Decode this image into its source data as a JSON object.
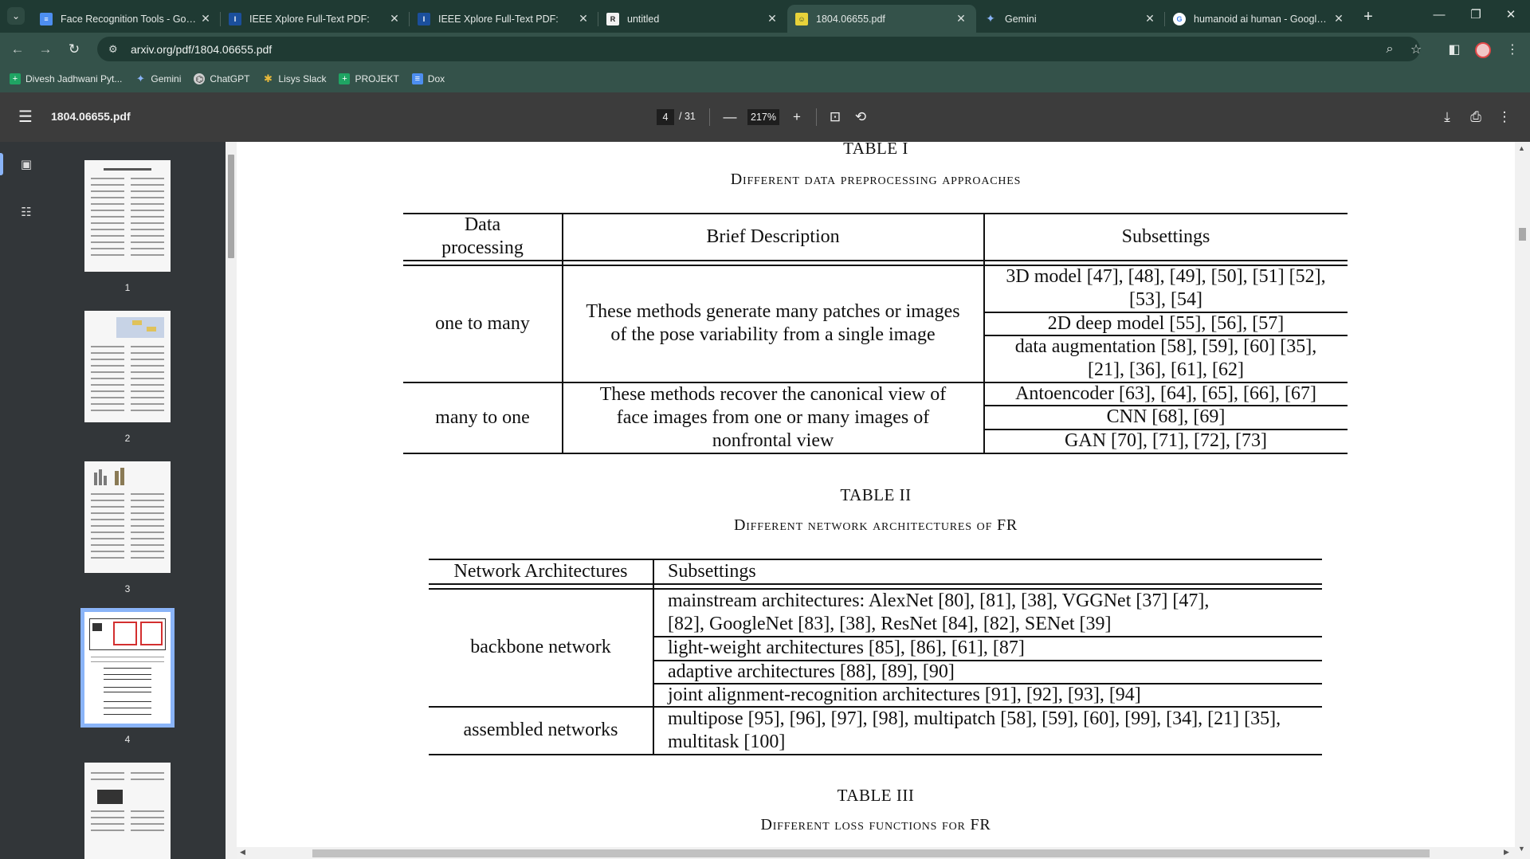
{
  "browser": {
    "tabs": [
      {
        "title": "Face Recognition Tools - Googl",
        "icon": "docs-icon",
        "active": false
      },
      {
        "title": "IEEE Xplore Full-Text PDF:",
        "icon": "ieee-icon",
        "active": false
      },
      {
        "title": "IEEE Xplore Full-Text PDF:",
        "icon": "ieee-icon",
        "active": false
      },
      {
        "title": "untitled",
        "icon": "r-icon",
        "active": false
      },
      {
        "title": "1804.06655.pdf",
        "icon": "pdf-icon",
        "active": true
      },
      {
        "title": "Gemini",
        "icon": "gemini-icon",
        "active": false
      },
      {
        "title": "humanoid ai human - Google S",
        "icon": "google-icon",
        "active": false
      }
    ],
    "url": "arxiv.org/pdf/1804.06655.pdf",
    "bookmarks": [
      {
        "label": "Divesh Jadhwani Pyt...",
        "icon": "sheets-icon",
        "color": "#1fa463"
      },
      {
        "label": "Gemini",
        "icon": "gemini-icon",
        "color": "#8ab4f8"
      },
      {
        "label": "ChatGPT",
        "icon": "chatgpt-icon",
        "color": "#d0d0d0"
      },
      {
        "label": "Lisys Slack",
        "icon": "slack-icon",
        "color": "#e8b93b"
      },
      {
        "label": "PROJEKT",
        "icon": "sheets-icon",
        "color": "#1fa463"
      },
      {
        "label": "Dox",
        "icon": "docs-icon",
        "color": "#4d8ef0"
      }
    ]
  },
  "viewer": {
    "filename": "1804.06655.pdf",
    "current_page": "4",
    "total_pages": "/ 31",
    "zoom": "217%",
    "thumbnails": [
      "1",
      "2",
      "3",
      "4"
    ]
  },
  "document": {
    "table1": {
      "caption": "TABLE I",
      "subtitle": "Different data preprocessing approaches",
      "headers": [
        "Data processing",
        "Brief Description",
        "Subsettings"
      ],
      "header_col1_lines": [
        "Data",
        "processing"
      ],
      "rows": [
        {
          "category": "one to many",
          "description": "These methods generate many patches or images of the pose variability from a single image",
          "subsettings": [
            "3D model [47], [48], [49], [50], [51] [52], [53], [54]",
            "2D deep model [55], [56], [57]",
            "data augmentation [58], [59], [60] [35], [21], [36], [61], [62]"
          ]
        },
        {
          "category": "many to one",
          "description": "These methods recover the canonical view of face images from one or many images of nonfrontal view",
          "subsettings": [
            "Antoencoder [63], [64], [65], [66], [67]",
            "CNN [68], [69]",
            "GAN [70], [71], [72], [73]"
          ]
        }
      ]
    },
    "table2": {
      "caption": "TABLE II",
      "subtitle": "Different network architectures of FR",
      "headers": [
        "Network Architectures",
        "Subsettings"
      ],
      "rows": [
        {
          "category": "backbone network",
          "subsettings": [
            "mainstream architectures: AlexNet [80], [81], [38], VGGNet [37] [47], [82], GoogleNet [83], [38], ResNet [84], [82], SENet [39]",
            "light-weight architectures [85], [86], [61], [87]",
            "adaptive architectures [88], [89], [90]",
            "joint alignment-recognition architectures [91], [92], [93], [94]"
          ]
        },
        {
          "category": "assembled networks",
          "subsettings": [
            "multipose [95], [96], [97], [98], multipatch [58], [59], [60], [99], [34], [21] [35], multitask [100]"
          ]
        }
      ]
    },
    "table3": {
      "caption": "TABLE III",
      "subtitle": "Different loss functions for FR"
    }
  }
}
